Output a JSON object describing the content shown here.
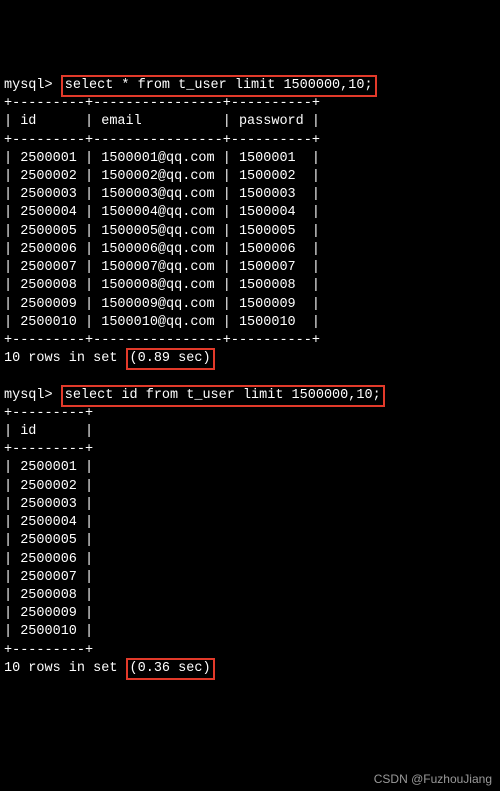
{
  "q1": {
    "prompt": "mysql>",
    "sql": "select * from t_user limit 1500000,10;",
    "cols": [
      "id",
      "email",
      "password"
    ],
    "rows": [
      [
        "2500001",
        "1500001@qq.com",
        "1500001"
      ],
      [
        "2500002",
        "1500002@qq.com",
        "1500002"
      ],
      [
        "2500003",
        "1500003@qq.com",
        "1500003"
      ],
      [
        "2500004",
        "1500004@qq.com",
        "1500004"
      ],
      [
        "2500005",
        "1500005@qq.com",
        "1500005"
      ],
      [
        "2500006",
        "1500006@qq.com",
        "1500006"
      ],
      [
        "2500007",
        "1500007@qq.com",
        "1500007"
      ],
      [
        "2500008",
        "1500008@qq.com",
        "1500008"
      ],
      [
        "2500009",
        "1500009@qq.com",
        "1500009"
      ],
      [
        "2500010",
        "1500010@qq.com",
        "1500010"
      ]
    ],
    "result_prefix": "10 rows in set ",
    "timing": "(0.89 sec)",
    "hr3": "+---------+----------------+----------+",
    "header_row": "| id      | email          | password |"
  },
  "q2": {
    "prompt": "mysql>",
    "sql": "select id from t_user limit 1500000,10;",
    "cols": [
      "id"
    ],
    "rows": [
      [
        "2500001"
      ],
      [
        "2500002"
      ],
      [
        "2500003"
      ],
      [
        "2500004"
      ],
      [
        "2500005"
      ],
      [
        "2500006"
      ],
      [
        "2500007"
      ],
      [
        "2500008"
      ],
      [
        "2500009"
      ],
      [
        "2500010"
      ]
    ],
    "result_prefix": "10 rows in set ",
    "timing": "(0.36 sec)",
    "hr1": "+---------+",
    "header_row": "| id      |"
  },
  "watermark": "CSDN @FuzhouJiang"
}
